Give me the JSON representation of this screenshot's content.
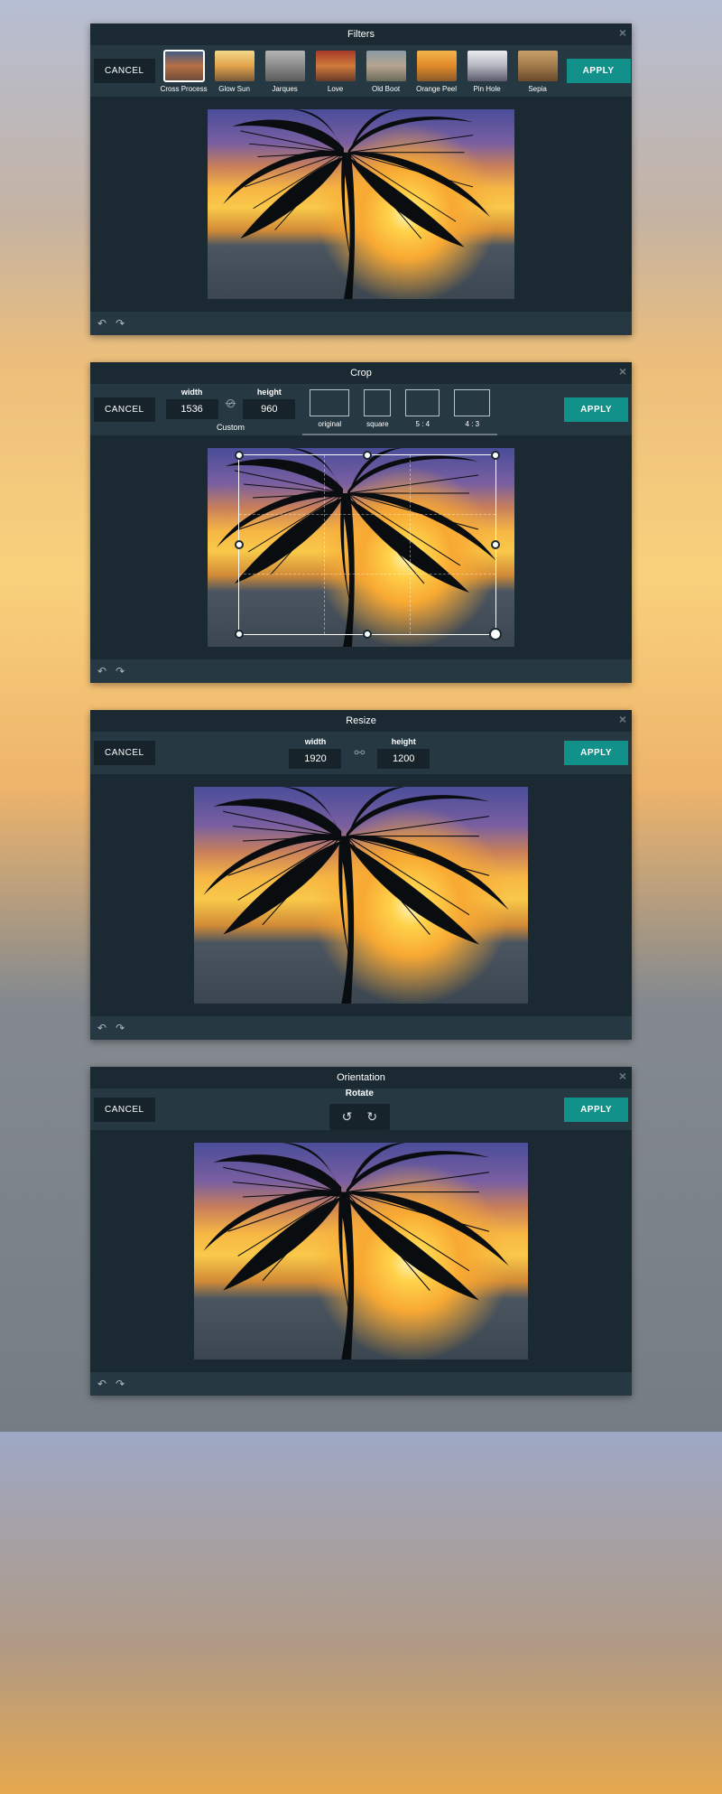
{
  "common": {
    "cancel": "CANCEL",
    "apply": "APPLY",
    "close": "×"
  },
  "filters_panel": {
    "title": "Filters",
    "items": [
      {
        "label": "Cross Process"
      },
      {
        "label": "Glow Sun"
      },
      {
        "label": "Jarques"
      },
      {
        "label": "Love"
      },
      {
        "label": "Old Boot"
      },
      {
        "label": "Orange Peel"
      },
      {
        "label": "Pin Hole"
      },
      {
        "label": "Sepia"
      }
    ],
    "selected_index": 0
  },
  "crop_panel": {
    "title": "Crop",
    "width_label": "width",
    "height_label": "height",
    "width_value": "1536",
    "height_value": "960",
    "link_broken": true,
    "custom_label": "Custom",
    "aspects": [
      {
        "label": "original"
      },
      {
        "label": "square"
      },
      {
        "label": "5 : 4"
      },
      {
        "label": "4 : 3"
      }
    ]
  },
  "resize_panel": {
    "title": "Resize",
    "width_label": "width",
    "height_label": "height",
    "width_value": "1920",
    "height_value": "1200",
    "linked": true
  },
  "orientation_panel": {
    "title": "Orientation",
    "rotate_label": "Rotate"
  }
}
